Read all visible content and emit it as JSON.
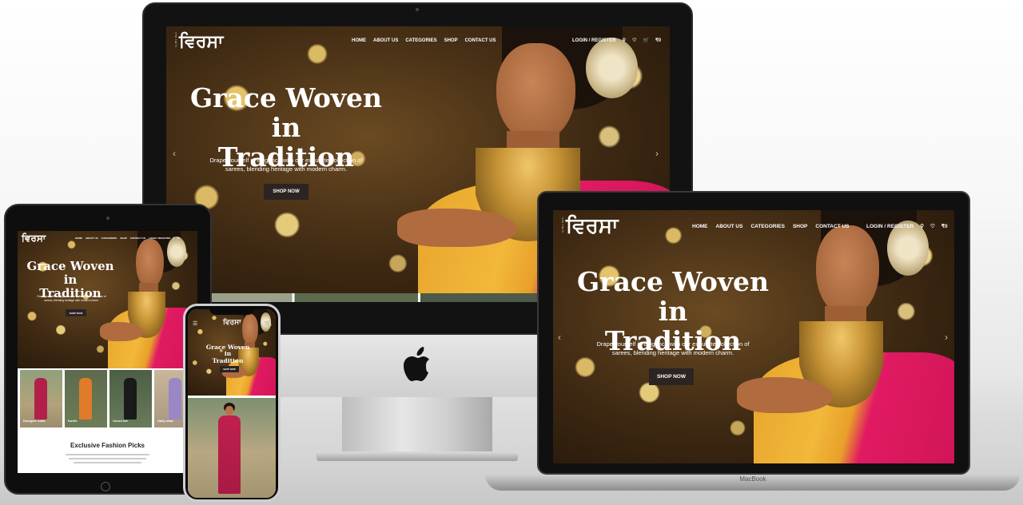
{
  "brand": {
    "logo_text": "ਵਿਰਸਾ",
    "logo_tag": "by Mrs. Kaur"
  },
  "nav": {
    "items": [
      "HOME",
      "ABOUT US",
      "CATEGORIES",
      "SHOP",
      "CONTACT US"
    ],
    "login": "LOGIN / REGISTER",
    "cart_total": "₹0",
    "wishlist_count": "0",
    "cart_count": "0"
  },
  "hero": {
    "title_line1": "Grace Woven in",
    "title_line2": "Tradition",
    "subtitle_line1": "Drape yourself in elegance with our exquisite collection of",
    "subtitle_line2": "sarees, blending heritage with modern charm.",
    "cta": "SHOP NOW"
  },
  "categories": [
    "Designer suits",
    "Kurtis",
    "Coord set",
    "Daily wear"
  ],
  "section": {
    "title": "Exclusive Fashion Picks"
  },
  "device": {
    "macbook_label": "MacBook"
  },
  "colors": {
    "accent_pink": "#d01457",
    "accent_gold": "#e7a52c",
    "button_dark": "#2b2422"
  }
}
